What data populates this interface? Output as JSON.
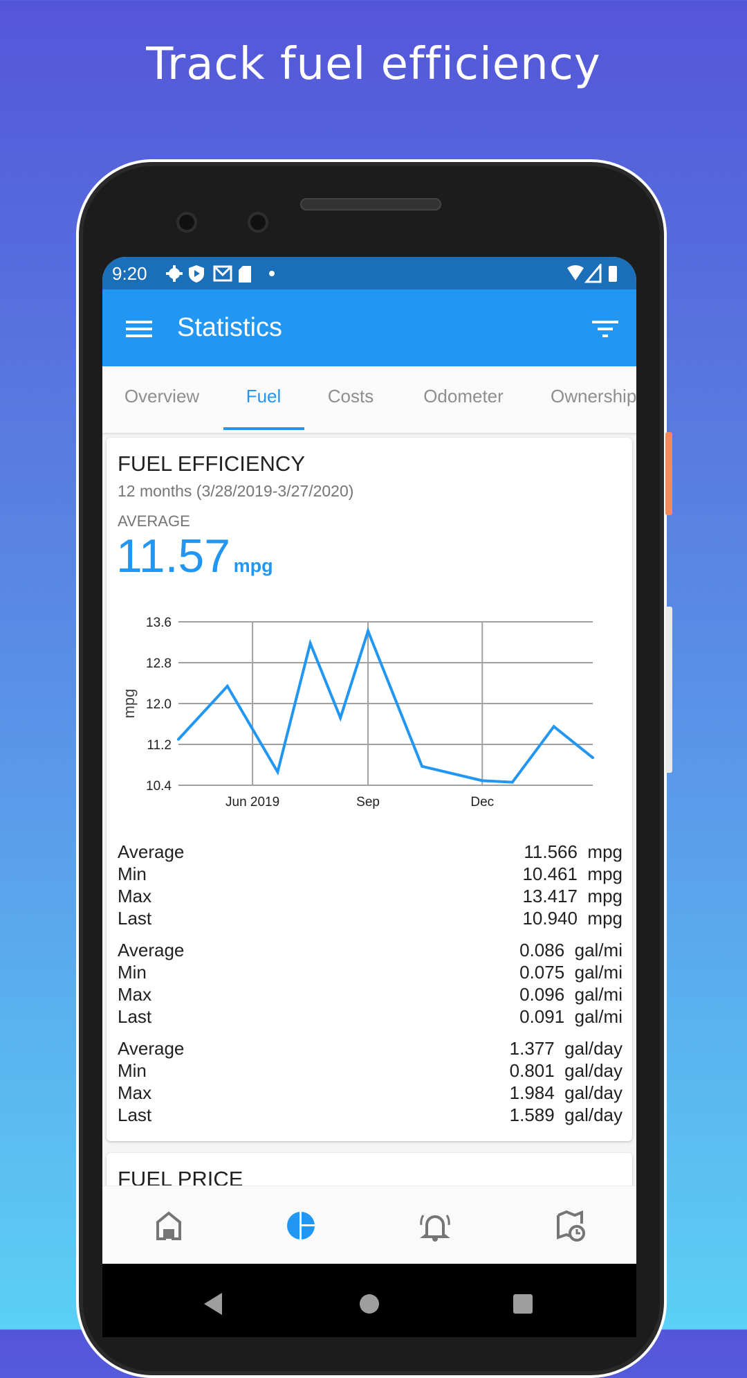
{
  "headline": "Track fuel efficiency",
  "status_bar": {
    "time": "9:20",
    "icons": [
      "gear-icon",
      "shield-play-icon",
      "mail-icon",
      "sd-card-icon",
      "dot-icon",
      "wifi-icon",
      "signal-icon",
      "battery-icon"
    ]
  },
  "app_bar": {
    "title": "Statistics",
    "menu_icon": "hamburger-icon",
    "filter_icon": "filter-icon"
  },
  "tabs": [
    {
      "label": "Overview"
    },
    {
      "label": "Fuel",
      "active": true
    },
    {
      "label": "Costs"
    },
    {
      "label": "Odometer"
    },
    {
      "label": "Ownership"
    }
  ],
  "fuel_efficiency": {
    "title": "FUEL EFFICIENCY",
    "period": "12 months (3/28/2019-3/27/2020)",
    "average_label": "AVERAGE",
    "average_value": "11.57",
    "average_unit": "mpg",
    "stats": [
      [
        {
          "label": "Average",
          "value": "11.566  mpg"
        },
        {
          "label": "Min",
          "value": "10.461  mpg"
        },
        {
          "label": "Max",
          "value": "13.417  mpg"
        },
        {
          "label": "Last",
          "value": "10.940  mpg"
        }
      ],
      [
        {
          "label": "Average",
          "value": "0.086  gal/mi"
        },
        {
          "label": "Min",
          "value": "0.075  gal/mi"
        },
        {
          "label": "Max",
          "value": "0.096  gal/mi"
        },
        {
          "label": "Last",
          "value": "0.091  gal/mi"
        }
      ],
      [
        {
          "label": "Average",
          "value": "1.377  gal/day"
        },
        {
          "label": "Min",
          "value": "0.801  gal/day"
        },
        {
          "label": "Max",
          "value": "1.984  gal/day"
        },
        {
          "label": "Last",
          "value": "1.589  gal/day"
        }
      ]
    ]
  },
  "chart_data": {
    "type": "line",
    "ylabel": "mpg",
    "ylim": [
      10.4,
      13.6
    ],
    "yticks": [
      "10.4",
      "11.2",
      "12.0",
      "12.8",
      "13.6"
    ],
    "xticks": [
      {
        "date": "2019-06-01",
        "label": "Jun 2019"
      },
      {
        "date": "2019-09-01",
        "label": "Sep"
      },
      {
        "date": "2019-12-01",
        "label": "Dec"
      }
    ],
    "grid": true,
    "color": "#2196f3",
    "x": [
      "2019-04-03",
      "2019-05-12",
      "2019-06-21",
      "2019-07-17",
      "2019-08-10",
      "2019-09-01",
      "2019-10-14",
      "2019-12-01",
      "2019-12-25",
      "2020-01-27",
      "2020-02-27"
    ],
    "y": [
      11.3,
      12.34,
      10.66,
      13.18,
      11.72,
      13.42,
      10.77,
      10.49,
      10.46,
      11.55,
      10.94
    ]
  },
  "fuel_price": {
    "title": "FUEL PRICE"
  },
  "bottom_nav": [
    {
      "icon": "home-icon"
    },
    {
      "icon": "pie-chart-icon",
      "active": true
    },
    {
      "icon": "bell-ring-icon"
    },
    {
      "icon": "map-clock-icon"
    }
  ],
  "colors": {
    "primary": "#2196f3",
    "status_bar": "#1b6fb8",
    "inactive": "#757575"
  }
}
